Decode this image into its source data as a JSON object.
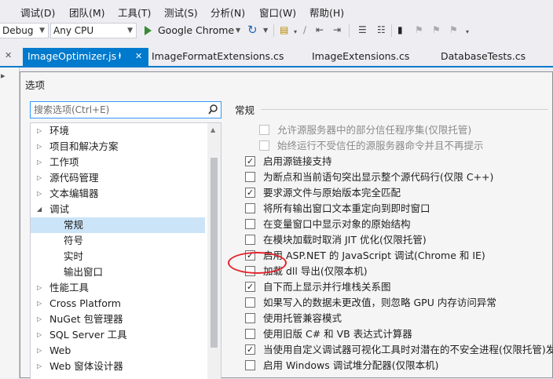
{
  "menubar": {
    "items": [
      "调试(D)",
      "团队(M)",
      "工具(T)",
      "测试(S)",
      "分析(N)",
      "窗口(W)",
      "帮助(H)"
    ]
  },
  "toolbar": {
    "config_value": "Debug",
    "platform_value": "Any CPU",
    "run_target_label": "Google Chrome",
    "run_icon": "play-icon",
    "refresh_icon": "refresh-icon"
  },
  "tabs": [
    {
      "label": "ImageOptimizer.js",
      "active": true
    },
    {
      "label": "ImageFormatExtensions.cs",
      "active": false
    },
    {
      "label": "ImageExtensions.cs",
      "active": false
    },
    {
      "label": "DatabaseTests.cs",
      "active": false
    }
  ],
  "tab_pin_glyph": "ⱡ",
  "tab_close_glyph": "✕",
  "dialog": {
    "title": "选项",
    "search_placeholder": "搜索选项(Ctrl+E)",
    "section_heading": "常规"
  },
  "tree": [
    {
      "label": "环境",
      "level": 0,
      "expander": "▷"
    },
    {
      "label": "项目和解决方案",
      "level": 0,
      "expander": "▷"
    },
    {
      "label": "工作项",
      "level": 0,
      "expander": "▷"
    },
    {
      "label": "源代码管理",
      "level": 0,
      "expander": "▷"
    },
    {
      "label": "文本编辑器",
      "level": 0,
      "expander": "▷"
    },
    {
      "label": "调试",
      "level": 0,
      "expander": "◢"
    },
    {
      "label": "常规",
      "level": 1,
      "expander": "",
      "selected": true
    },
    {
      "label": "符号",
      "level": 1,
      "expander": ""
    },
    {
      "label": "实时",
      "level": 1,
      "expander": ""
    },
    {
      "label": "输出窗口",
      "level": 1,
      "expander": ""
    },
    {
      "label": "性能工具",
      "level": 0,
      "expander": "▷"
    },
    {
      "label": "Cross Platform",
      "level": 0,
      "expander": "▷"
    },
    {
      "label": "NuGet 包管理器",
      "level": 0,
      "expander": "▷"
    },
    {
      "label": "SQL Server 工具",
      "level": 0,
      "expander": "▷"
    },
    {
      "label": "Web",
      "level": 0,
      "expander": "▷"
    },
    {
      "label": "Web 窗体设计器",
      "level": 0,
      "expander": "▷"
    }
  ],
  "options": [
    {
      "label": "允许源服务器中的部分信任程序集(仅限托管)",
      "checked": false,
      "indent": 1,
      "disabled": true
    },
    {
      "label": "始终运行不受信任的源服务器命令并且不再提示",
      "checked": false,
      "indent": 1,
      "disabled": true
    },
    {
      "label": "启用源链接支持",
      "checked": true,
      "indent": 0,
      "disabled": false
    },
    {
      "label": "为断点和当前语句突出显示整个源代码行(仅限 C++)",
      "checked": false,
      "indent": 0,
      "disabled": false
    },
    {
      "label": "要求源文件与原始版本完全匹配",
      "checked": true,
      "indent": 0,
      "disabled": false
    },
    {
      "label": "将所有输出窗口文本重定向到即时窗口",
      "checked": false,
      "indent": 0,
      "disabled": false
    },
    {
      "label": "在变量窗口中显示对象的原始结构",
      "checked": false,
      "indent": 0,
      "disabled": false
    },
    {
      "label": "在模块加载时取消 JIT 优化(仅限托管)",
      "checked": false,
      "indent": 0,
      "disabled": false
    },
    {
      "label": "启用 ASP.NET 的 JavaScript 调试(Chrome 和 IE)",
      "checked": true,
      "indent": 0,
      "disabled": false
    },
    {
      "label": "加载 dll 导出(仅限本机)",
      "checked": false,
      "indent": 0,
      "disabled": false
    },
    {
      "label": "自下而上显示并行堆栈关系图",
      "checked": true,
      "indent": 0,
      "disabled": false
    },
    {
      "label": "如果写入的数据未更改值，则忽略 GPU 内存访问异常",
      "checked": false,
      "indent": 0,
      "disabled": false
    },
    {
      "label": "使用托管兼容模式",
      "checked": false,
      "indent": 0,
      "disabled": false
    },
    {
      "label": "使用旧版 C# 和 VB 表达式计算器",
      "checked": false,
      "indent": 0,
      "disabled": false
    },
    {
      "label": "当使用自定义调试器可视化工具时对潜在的不安全进程(仅限托管)发出警",
      "checked": true,
      "indent": 0,
      "disabled": false
    },
    {
      "label": "启用 Windows 调试堆分配器(仅限本机)",
      "checked": false,
      "indent": 0,
      "disabled": false
    }
  ],
  "check_glyph": "✓",
  "colors": {
    "accent": "#007acc",
    "highlight_circle": "#e3242b",
    "selection": "#cce4f7"
  }
}
